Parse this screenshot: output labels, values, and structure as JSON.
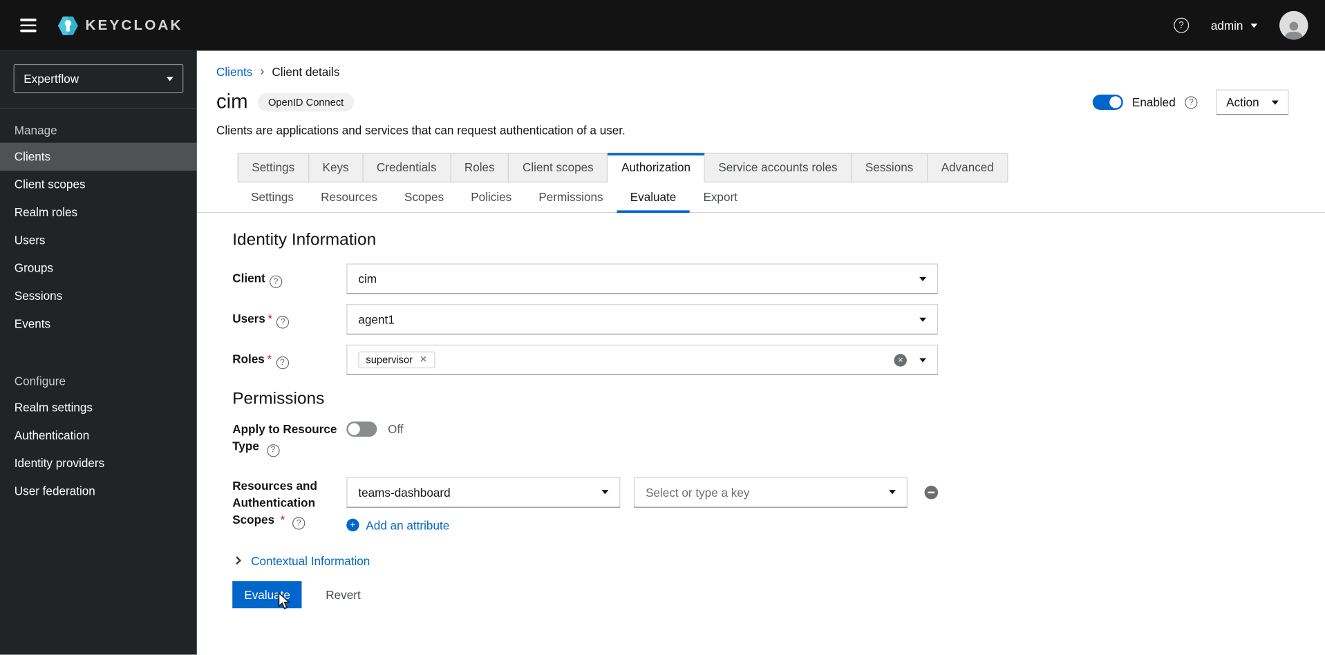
{
  "colors": {
    "accent": "#0066cc",
    "masthead_bg": "#131313",
    "sidebar_bg": "#212427",
    "danger": "#c9190b",
    "toggle_on": "#0066cc",
    "toggle_off": "#8a8d90"
  },
  "icons": {
    "help_glyph": "?",
    "close_glyph": "✕",
    "plus_glyph": "+",
    "breadcrumb_separator": "›"
  },
  "header": {
    "brand_text": "KEYCLOAK",
    "user_menu": {
      "label": "admin"
    }
  },
  "sidebar": {
    "realm_selector": {
      "value": "Expertflow"
    },
    "sections": [
      {
        "title": "Manage",
        "items": [
          {
            "label": "Clients",
            "active": true
          },
          {
            "label": "Client scopes",
            "active": false
          },
          {
            "label": "Realm roles",
            "active": false
          },
          {
            "label": "Users",
            "active": false
          },
          {
            "label": "Groups",
            "active": false
          },
          {
            "label": "Sessions",
            "active": false
          },
          {
            "label": "Events",
            "active": false
          }
        ]
      },
      {
        "title": "Configure",
        "items": [
          {
            "label": "Realm settings",
            "active": false
          },
          {
            "label": "Authentication",
            "active": false
          },
          {
            "label": "Identity providers",
            "active": false
          },
          {
            "label": "User federation",
            "active": false
          }
        ]
      }
    ]
  },
  "breadcrumb": {
    "items": [
      {
        "label": "Clients"
      },
      {
        "label": "Client details"
      }
    ]
  },
  "page_header": {
    "title": "cim",
    "protocol_badge": "OpenID Connect",
    "description": "Clients are applications and services that can request authentication of a user.",
    "enabled_toggle": {
      "state": "on",
      "label": "Enabled"
    },
    "action_dropdown": {
      "label": "Action"
    }
  },
  "tabs": {
    "active": "Authorization",
    "items": [
      "Settings",
      "Keys",
      "Credentials",
      "Roles",
      "Client scopes",
      "Authorization",
      "Service accounts roles",
      "Sessions",
      "Advanced"
    ]
  },
  "subtabs": {
    "active": "Evaluate",
    "items": [
      "Settings",
      "Resources",
      "Scopes",
      "Policies",
      "Permissions",
      "Evaluate",
      "Export"
    ]
  },
  "identity_section": {
    "heading": "Identity Information",
    "client_field": {
      "label": "Client",
      "value": "cim"
    },
    "users_field": {
      "label": "Users",
      "required": "*",
      "value": "agent1"
    },
    "roles_field": {
      "label": "Roles",
      "required": "*",
      "chips": [
        {
          "label": "supervisor"
        }
      ]
    }
  },
  "permissions_section": {
    "heading": "Permissions",
    "apply_to_resource_type": {
      "label": "Apply to Resource Type",
      "value": "Off"
    },
    "resources_field": {
      "label": "Resources and Authentication Scopes",
      "required": "*",
      "resource_value": "teams-dashboard",
      "key_placeholder": "Select or type a key"
    },
    "add_attribute_label": "Add an attribute"
  },
  "contextual_info": {
    "label": "Contextual Information"
  },
  "actions": {
    "evaluate_label": "Evaluate",
    "revert_label": "Revert"
  }
}
